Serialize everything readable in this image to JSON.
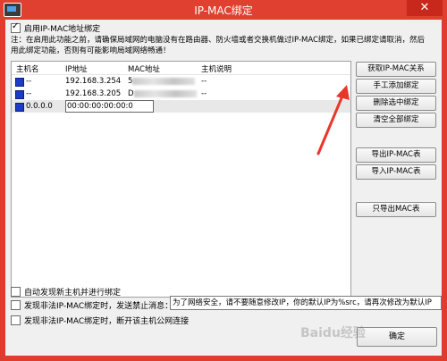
{
  "window": {
    "title": "IP-MAC绑定",
    "close_symbol": "✕"
  },
  "enable_binding": {
    "label": "启用IP-MAC地址绑定",
    "checked": true
  },
  "note": "注：在启用此功能之前，请确保局域网的电脑没有在路由器、防火墙或者交换机做过IP-MAC绑定，如果已绑定请取消，然后用此绑定功能，否则有可能影响局域网络畅通！",
  "table": {
    "headers": [
      "主机名",
      "IP地址",
      "MAC地址",
      "主机说明"
    ],
    "rows": [
      {
        "host": "--",
        "ip": "192.168.3.254",
        "mac_prefix": "5",
        "desc": "--"
      },
      {
        "host": "--",
        "ip": "192.168.3.205",
        "mac_prefix": "D",
        "desc": "--"
      },
      {
        "host": "0.0.0.0",
        "ip": "00:00:00:00:00:0",
        "mac_prefix": "",
        "desc": ""
      }
    ]
  },
  "buttons": {
    "get_relation": "获取IP-MAC关系",
    "manual_add": "手工添加绑定",
    "delete_selected": "删除选中绑定",
    "clear_all": "清空全部绑定",
    "export": "导出IP-MAC表",
    "import": "导入IP-MAC表",
    "export_mac_only": "只导出MAC表",
    "bottom": "确定"
  },
  "options": {
    "auto_discover": {
      "label": "自动发现新主机并进行绑定",
      "checked": false
    },
    "send_message": {
      "label": "发现非法IP-MAC绑定时，发送禁止消息：",
      "checked": false
    },
    "disconnect": {
      "label": "发现非法IP-MAC绑定时，断开该主机公网连接",
      "checked": false
    }
  },
  "message_field": {
    "value": "为了网络安全，请不要随意修改IP，你的默认IP为%src，请再次修改为默认IP"
  },
  "watermark": {
    "text": "Baidu经验"
  },
  "colors": {
    "titlebar": "#e0402f",
    "close_button": "#c7281b",
    "arrow": "#e8362a"
  }
}
